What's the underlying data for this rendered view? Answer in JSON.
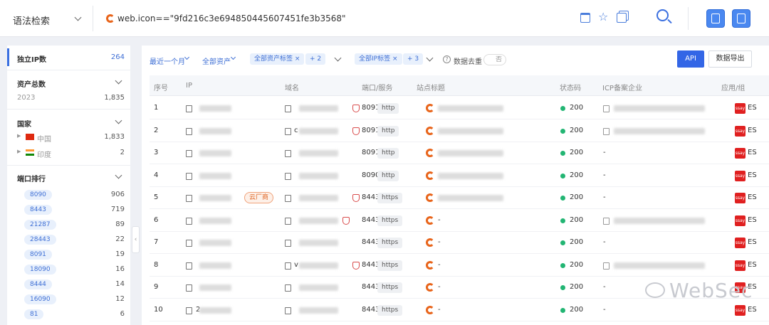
{
  "header": {
    "mode_label": "语法检索",
    "query": "web.icon==\"9fd216c3e694850445607451fe3b3568\""
  },
  "sidebar": {
    "unique_ip": {
      "label": "独立IP数",
      "count": "264"
    },
    "assets": {
      "title": "资产总数",
      "items": [
        {
          "label": "2023",
          "count": "1,835"
        }
      ]
    },
    "country": {
      "title": "国家",
      "items": [
        {
          "label": "中国",
          "count": "1,833"
        },
        {
          "label": "印度",
          "count": "2"
        }
      ]
    },
    "ports": {
      "title": "端口排行",
      "items": [
        {
          "port": "8090",
          "count": "906"
        },
        {
          "port": "8443",
          "count": "719"
        },
        {
          "port": "21287",
          "count": "89"
        },
        {
          "port": "28443",
          "count": "22"
        },
        {
          "port": "8091",
          "count": "19"
        },
        {
          "port": "18090",
          "count": "16"
        },
        {
          "port": "8444",
          "count": "14"
        },
        {
          "port": "16090",
          "count": "12"
        },
        {
          "port": "81",
          "count": "6"
        }
      ]
    }
  },
  "filters": {
    "time": "最近一个月",
    "asset": "全部资产",
    "asset_tag": "全部资产标签",
    "asset_tag_more": "+ 2",
    "ip_tag": "全部IP标签",
    "ip_tag_more": "+ 3",
    "dedupe": "数据去重",
    "dedupe_toggle": "否",
    "api": "API",
    "export": "数据导出"
  },
  "table": {
    "columns": [
      "序号",
      "IP",
      "域名",
      "端口/服务",
      "站点标题",
      "状态码",
      "ICP备案企业",
      "应用/组"
    ],
    "rows": [
      {
        "n": "1",
        "ip_prefix": "",
        "domain_prefix": "",
        "port": "8091",
        "proto": "http",
        "title": "",
        "status": "200",
        "icp": "",
        "app": "ES"
      },
      {
        "n": "2",
        "ip_prefix": "",
        "domain_prefix": "c",
        "port": "8091",
        "proto": "http",
        "title": "",
        "status": "200",
        "icp": "",
        "app": "ES"
      },
      {
        "n": "3",
        "ip_prefix": "",
        "domain_prefix": "",
        "port": "8091",
        "proto": "http",
        "title": "",
        "status": "200",
        "icp": "-",
        "app": "ES"
      },
      {
        "n": "4",
        "ip_prefix": "",
        "domain_prefix": "",
        "port": "8090",
        "proto": "http",
        "title": "",
        "status": "200",
        "icp": "-",
        "app": "ES"
      },
      {
        "n": "5",
        "ip_prefix": "",
        "domain_prefix": "",
        "port": "8443",
        "proto": "https",
        "title": "",
        "status": "200",
        "icp": "-",
        "app": "ES",
        "cloud": "云厂商"
      },
      {
        "n": "6",
        "ip_prefix": "",
        "domain_prefix": "",
        "port": "8443",
        "proto": "https",
        "title": "-",
        "status": "200",
        "icp": "",
        "app": "ES"
      },
      {
        "n": "7",
        "ip_prefix": "",
        "domain_prefix": "",
        "port": "8443",
        "proto": "https",
        "title": "-",
        "status": "200",
        "icp": "-",
        "app": "ES"
      },
      {
        "n": "8",
        "ip_prefix": "",
        "domain_prefix": "v",
        "port": "8443",
        "proto": "https",
        "title": "-",
        "status": "200",
        "icp": "",
        "app": "ES"
      },
      {
        "n": "9",
        "ip_prefix": "",
        "domain_prefix": "",
        "port": "8443",
        "proto": "https",
        "title": "-",
        "status": "200",
        "icp": "-",
        "app": "ES"
      },
      {
        "n": "10",
        "ip_prefix": "2",
        "domain_prefix": "",
        "port": "8443",
        "proto": "https",
        "title": "-",
        "status": "200",
        "icp": "-",
        "app": "ES"
      }
    ]
  },
  "watermark": "WebSec"
}
